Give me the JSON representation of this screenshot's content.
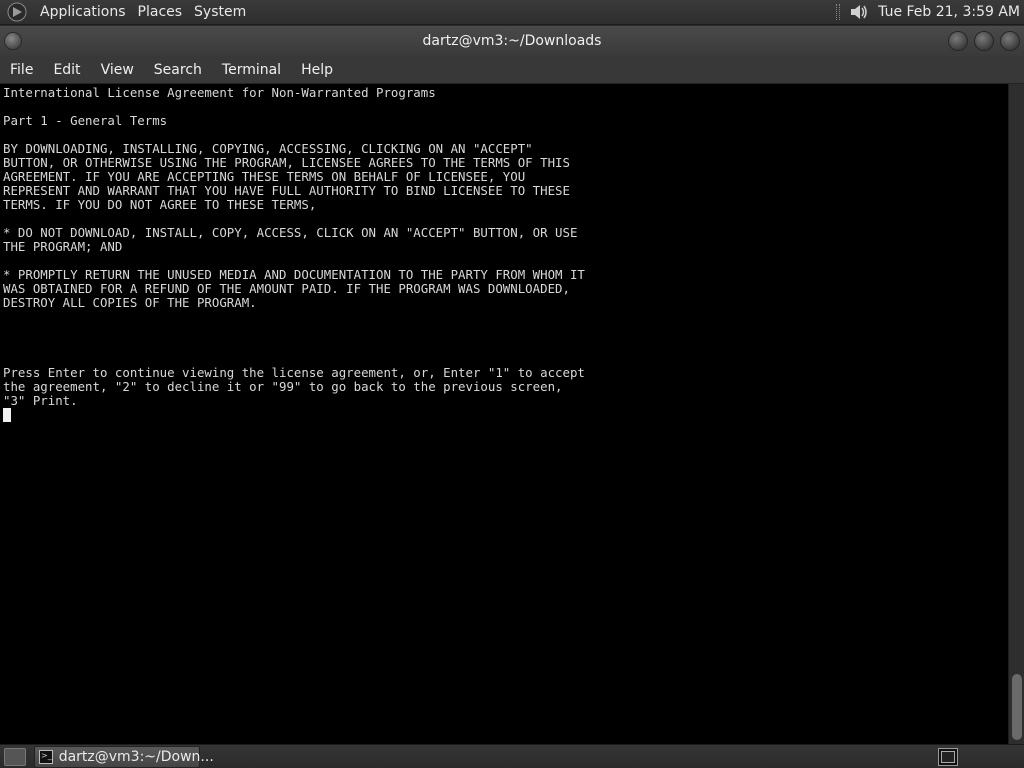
{
  "top_panel": {
    "menus": [
      "Applications",
      "Places",
      "System"
    ],
    "clock": "Tue Feb 21,  3:59 AM"
  },
  "window": {
    "title": "dartz@vm3:~/Downloads"
  },
  "menubar": {
    "items": [
      "File",
      "Edit",
      "View",
      "Search",
      "Terminal",
      "Help"
    ]
  },
  "terminal": {
    "lines": [
      "International License Agreement for Non-Warranted Programs",
      "",
      "Part 1 - General Terms",
      "",
      "BY DOWNLOADING, INSTALLING, COPYING, ACCESSING, CLICKING ON AN \"ACCEPT\"",
      "BUTTON, OR OTHERWISE USING THE PROGRAM, LICENSEE AGREES TO THE TERMS OF THIS",
      "AGREEMENT. IF YOU ARE ACCEPTING THESE TERMS ON BEHALF OF LICENSEE, YOU",
      "REPRESENT AND WARRANT THAT YOU HAVE FULL AUTHORITY TO BIND LICENSEE TO THESE",
      "TERMS. IF YOU DO NOT AGREE TO THESE TERMS,",
      "",
      "* DO NOT DOWNLOAD, INSTALL, COPY, ACCESS, CLICK ON AN \"ACCEPT\" BUTTON, OR USE",
      "THE PROGRAM; AND",
      "",
      "* PROMPTLY RETURN THE UNUSED MEDIA AND DOCUMENTATION TO THE PARTY FROM WHOM IT",
      "WAS OBTAINED FOR A REFUND OF THE AMOUNT PAID. IF THE PROGRAM WAS DOWNLOADED,",
      "DESTROY ALL COPIES OF THE PROGRAM.",
      "",
      "",
      "",
      "",
      "Press Enter to continue viewing the license agreement, or, Enter \"1\" to accept",
      "the agreement, \"2\" to decline it or \"99\" to go back to the previous screen,",
      "\"3\" Print."
    ]
  },
  "bottom_panel": {
    "task_label": "dartz@vm3:~/Down..."
  },
  "colors": {
    "terminal_bg": "#000000",
    "terminal_fg": "#d8d8d8",
    "panel_bg": "#2e2e2e"
  }
}
